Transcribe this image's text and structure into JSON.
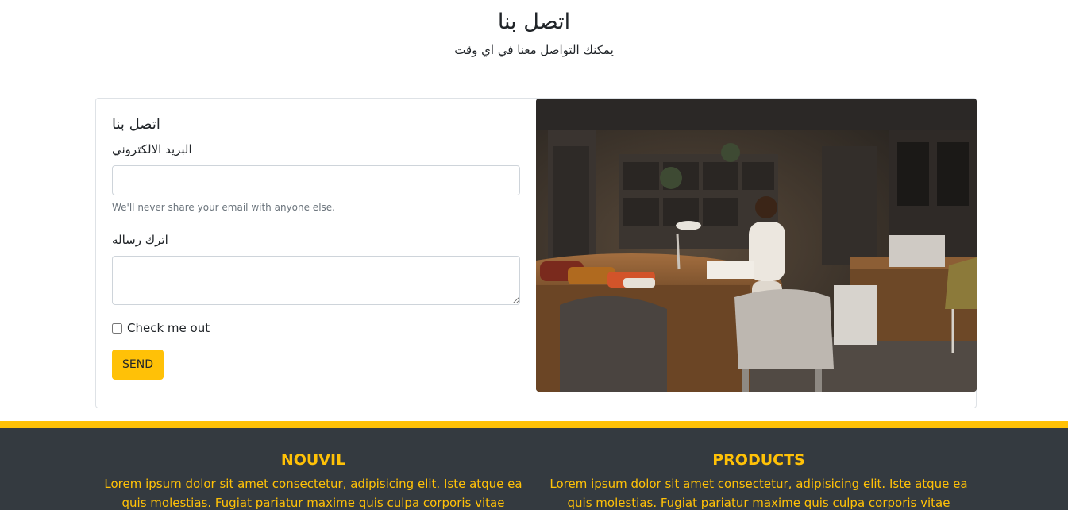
{
  "header": {
    "title": "اتصل بنا",
    "subtitle": "يمكنك التواصل معنا في اي وقت"
  },
  "contact_form": {
    "title": "اتصل بنا",
    "email_label": "البريد الالكتروني",
    "email_value": "",
    "email_help": "We'll never share your email with anyone else.",
    "message_label": "اترك رساله",
    "message_value": "",
    "checkbox_label": "Check me out",
    "checkbox_checked": false,
    "send_label": "SEND"
  },
  "footer": {
    "columns": [
      {
        "heading": "NOUVIL",
        "text": "Lorem ipsum dolor sit amet consectetur, adipisicing elit. Iste atque ea quis molestias. Fugiat pariatur maxime quis culpa corporis vitae repudiandae"
      },
      {
        "heading": "PRODUCTS",
        "text": "Lorem ipsum dolor sit amet consectetur, adipisicing elit. Iste atque ea quis molestias. Fugiat pariatur maxime quis culpa corporis vitae repudiandae"
      }
    ]
  },
  "colors": {
    "accent": "#ffc107",
    "footer_bg": "#343a40"
  }
}
